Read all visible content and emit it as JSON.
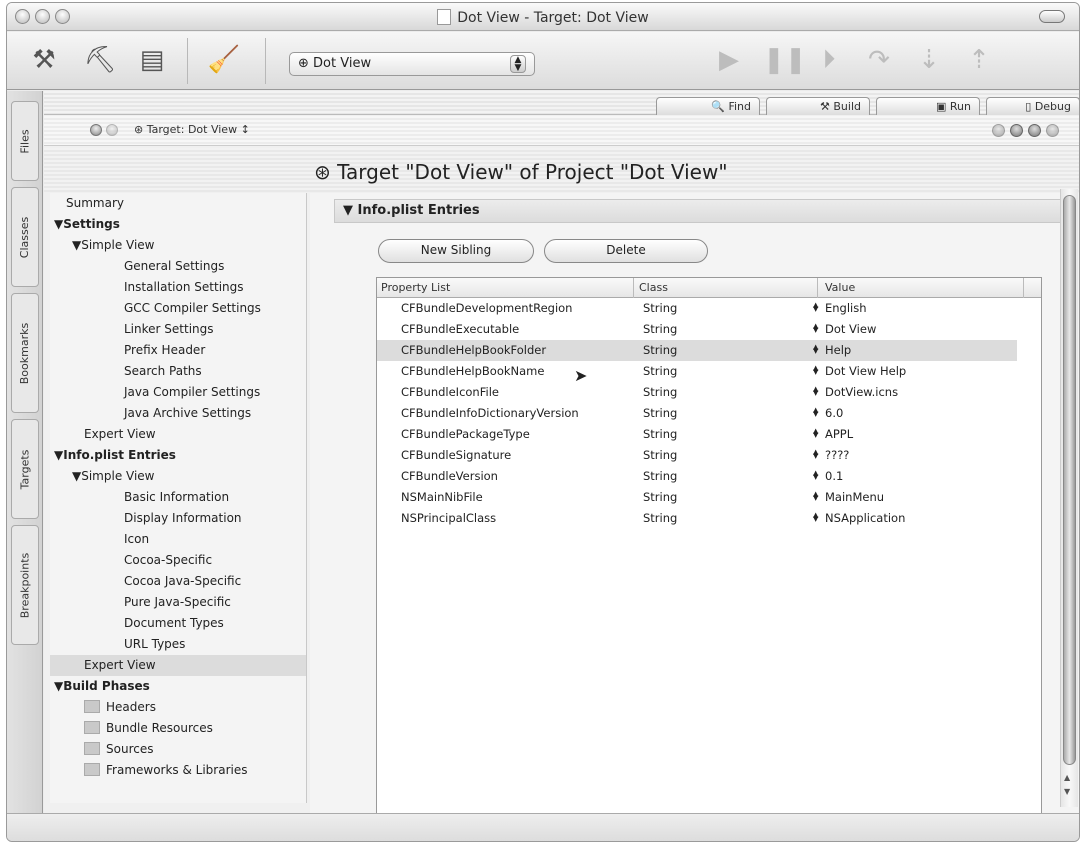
{
  "window": {
    "title": "Dot View - Target: Dot View"
  },
  "toolbar": {
    "build_icons": [
      "hammer-icon",
      "hammer-clean-icon",
      "build-and-go-icon",
      "broom-icon"
    ],
    "target_popup": "Dot View",
    "debug_icons": [
      "play-icon",
      "pause-icon",
      "step-icon",
      "step-over-icon",
      "step-into-icon",
      "step-out-icon"
    ]
  },
  "tabs": [
    "Files",
    "Classes",
    "Bookmarks",
    "Targets",
    "Breakpoints"
  ],
  "buttons": {
    "find": "Find",
    "build": "Build",
    "run": "Run",
    "debug": "Debug"
  },
  "nav": {
    "label": "Target: Dot View ↕"
  },
  "heading": "Target \"Dot View\" of Project \"Dot View\"",
  "sidebar": {
    "items": [
      {
        "label": "Summary",
        "indent": 0,
        "bold": false,
        "arrow": false
      },
      {
        "label": "Settings",
        "indent": 0,
        "bold": true,
        "arrow": true
      },
      {
        "label": "Simple View",
        "indent": 1,
        "bold": false,
        "arrow": true
      },
      {
        "label": "General Settings",
        "indent": 2,
        "bold": false,
        "arrow": false
      },
      {
        "label": "Installation Settings",
        "indent": 2,
        "bold": false,
        "arrow": false
      },
      {
        "label": "GCC Compiler Settings",
        "indent": 2,
        "bold": false,
        "arrow": false
      },
      {
        "label": "Linker Settings",
        "indent": 2,
        "bold": false,
        "arrow": false
      },
      {
        "label": "Prefix Header",
        "indent": 2,
        "bold": false,
        "arrow": false
      },
      {
        "label": "Search Paths",
        "indent": 2,
        "bold": false,
        "arrow": false
      },
      {
        "label": "Java Compiler Settings",
        "indent": 2,
        "bold": false,
        "arrow": false
      },
      {
        "label": "Java Archive Settings",
        "indent": 2,
        "bold": false,
        "arrow": false
      },
      {
        "label": "Expert View",
        "indent": 1,
        "bold": false,
        "arrow": false
      },
      {
        "label": "Info.plist Entries",
        "indent": 0,
        "bold": true,
        "arrow": true
      },
      {
        "label": "Simple View",
        "indent": 1,
        "bold": false,
        "arrow": true
      },
      {
        "label": "Basic Information",
        "indent": 2,
        "bold": false,
        "arrow": false
      },
      {
        "label": "Display Information",
        "indent": 2,
        "bold": false,
        "arrow": false
      },
      {
        "label": "Icon",
        "indent": 2,
        "bold": false,
        "arrow": false
      },
      {
        "label": "Cocoa-Specific",
        "indent": 2,
        "bold": false,
        "arrow": false
      },
      {
        "label": "Cocoa Java-Specific",
        "indent": 2,
        "bold": false,
        "arrow": false
      },
      {
        "label": "Pure Java-Specific",
        "indent": 2,
        "bold": false,
        "arrow": false
      },
      {
        "label": "Document Types",
        "indent": 2,
        "bold": false,
        "arrow": false
      },
      {
        "label": "URL Types",
        "indent": 2,
        "bold": false,
        "arrow": false
      },
      {
        "label": "Expert View",
        "indent": 1,
        "bold": false,
        "arrow": false,
        "selected": true
      },
      {
        "label": "Build Phases",
        "indent": 0,
        "bold": true,
        "arrow": true
      },
      {
        "label": "Headers",
        "indent": 1,
        "bold": false,
        "arrow": false,
        "phase": true
      },
      {
        "label": "Bundle Resources",
        "indent": 1,
        "bold": false,
        "arrow": false,
        "phase": true
      },
      {
        "label": "Sources",
        "indent": 1,
        "bold": false,
        "arrow": false,
        "phase": true
      },
      {
        "label": "Frameworks & Libraries",
        "indent": 1,
        "bold": false,
        "arrow": false,
        "phase": true
      }
    ]
  },
  "section": {
    "title": "Info.plist Entries",
    "new_sibling": "New Sibling",
    "delete": "Delete"
  },
  "table": {
    "headers": [
      "Property List",
      "Class",
      "Value"
    ],
    "rows": [
      {
        "key": "CFBundleDevelopmentRegion",
        "cls": "String",
        "value": "English"
      },
      {
        "key": "CFBundleExecutable",
        "cls": "String",
        "value": "Dot View"
      },
      {
        "key": "CFBundleHelpBookFolder",
        "cls": "String",
        "value": "Help",
        "selected": true
      },
      {
        "key": "CFBundleHelpBookName",
        "cls": "String",
        "value": "Dot View Help"
      },
      {
        "key": "CFBundleIconFile",
        "cls": "String",
        "value": "DotView.icns"
      },
      {
        "key": "CFBundleInfoDictionaryVersion",
        "cls": "String",
        "value": "6.0"
      },
      {
        "key": "CFBundlePackageType",
        "cls": "String",
        "value": "APPL"
      },
      {
        "key": "CFBundleSignature",
        "cls": "String",
        "value": "????"
      },
      {
        "key": "CFBundleVersion",
        "cls": "String",
        "value": "0.1"
      },
      {
        "key": "NSMainNibFile",
        "cls": "String",
        "value": "MainMenu"
      },
      {
        "key": "NSPrincipalClass",
        "cls": "String",
        "value": "NSApplication"
      }
    ]
  }
}
